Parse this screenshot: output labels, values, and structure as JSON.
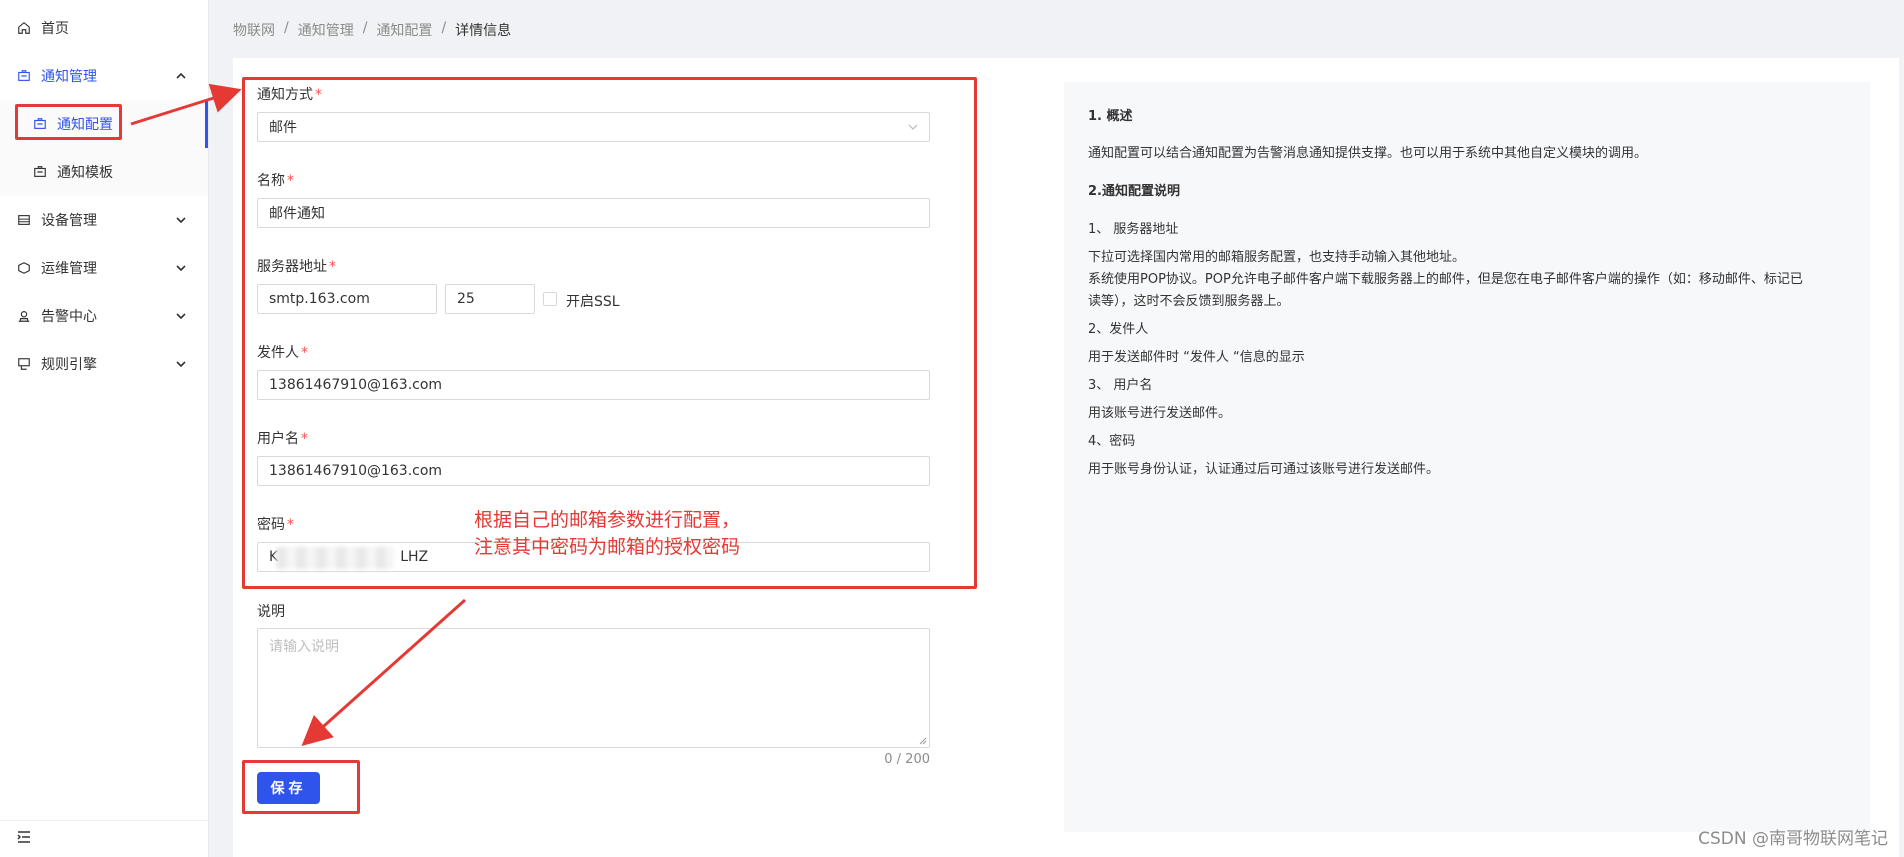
{
  "sidebar": {
    "items": [
      {
        "label": "首页",
        "icon": "home-icon"
      },
      {
        "label": "通知管理",
        "icon": "notice-icon"
      },
      {
        "label": "通知配置",
        "icon": "config-icon"
      },
      {
        "label": "通知模板",
        "icon": "template-icon"
      },
      {
        "label": "设备管理",
        "icon": "device-icon"
      },
      {
        "label": "运维管理",
        "icon": "ops-icon"
      },
      {
        "label": "告警中心",
        "icon": "alarm-icon"
      },
      {
        "label": "规则引擎",
        "icon": "rule-icon"
      }
    ]
  },
  "breadcrumb": [
    "物联网",
    "通知管理",
    "通知配置",
    "详情信息"
  ],
  "form": {
    "notify_type": {
      "label": "通知方式",
      "value": "邮件"
    },
    "name": {
      "label": "名称",
      "value": "邮件通知"
    },
    "server": {
      "label": "服务器地址",
      "host": "smtp.163.com",
      "port": "25",
      "ssl_label": "开启SSL"
    },
    "sender": {
      "label": "发件人",
      "value": "13861467910@163.com"
    },
    "username": {
      "label": "用户名",
      "value": "13861467910@163.com"
    },
    "password": {
      "label": "密码",
      "value_start": "K",
      "value_end": "LHZ"
    },
    "description": {
      "label": "说明",
      "placeholder": "请输入说明",
      "counter": "0 / 200"
    },
    "save_label": "保存"
  },
  "help": {
    "lines": [
      {
        "text": "1. 概述",
        "bold": true
      },
      {
        "text": "通知配置可以结合通知配置为告警消息通知提供支撑。也可以用于系统中其他自定义模块的调用。",
        "bold": false
      },
      {
        "text": "2.通知配置说明",
        "bold": true
      },
      {
        "text": "1、 服务器地址",
        "bold": false
      },
      {
        "text": "下拉可选择国内常用的邮箱服务配置，也支持手动输入其他地址。",
        "bold": false
      },
      {
        "text": "系统使用POP协议。POP允许电子邮件客户端下载服务器上的邮件，但是您在电子邮件客户端的操作（如：移动邮件、标记已",
        "bold": false
      },
      {
        "text": "读等），这时不会反馈到服务器上。",
        "bold": false
      },
      {
        "text": "2、发件人",
        "bold": false
      },
      {
        "text": "用于发送邮件时 “发件人 “信息的显示",
        "bold": false
      },
      {
        "text": "3、 用户名",
        "bold": false
      },
      {
        "text": "用该账号进行发送邮件。",
        "bold": false
      },
      {
        "text": "4、密码",
        "bold": false
      },
      {
        "text": "用于账号身份认证，认证通过后可通过该账号进行发送邮件。",
        "bold": false
      }
    ]
  },
  "annotation": {
    "line1": "根据自己的邮箱参数进行配置，",
    "line2": "注意其中密码为邮箱的授权密码",
    "color": "#e53935"
  },
  "watermark": "CSDN @南哥物联网笔记",
  "colors": {
    "primary": "#2f54eb",
    "required": "#ff4d4f",
    "annotation": "#e53935"
  }
}
